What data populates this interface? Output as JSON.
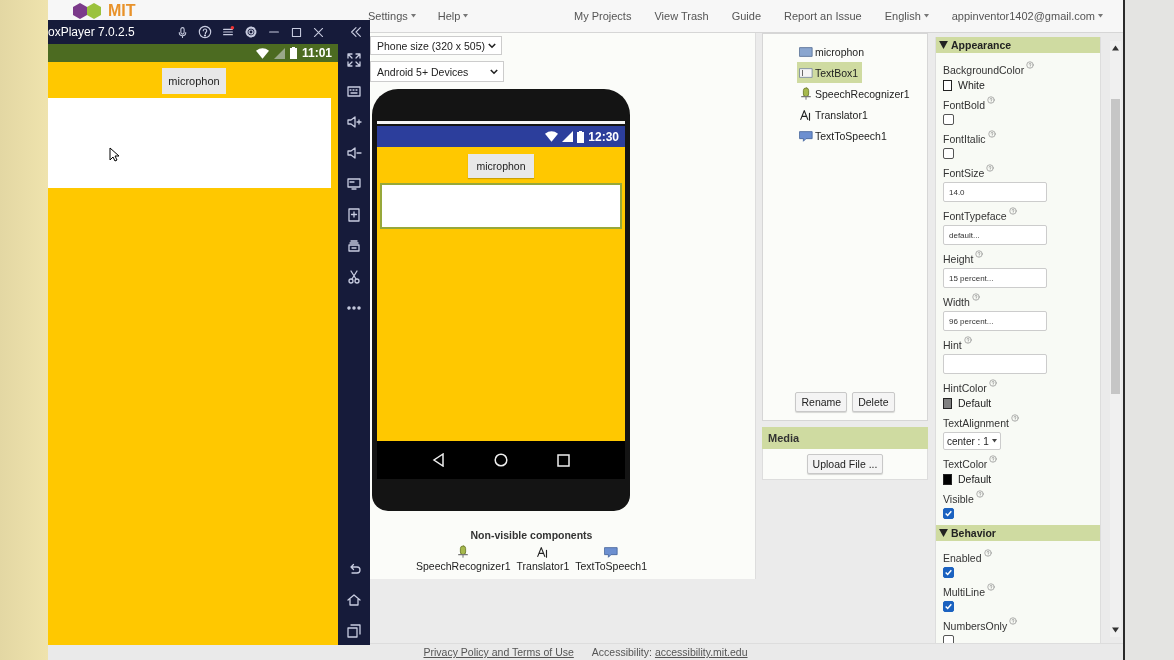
{
  "header": {
    "logo": "MIT",
    "menus": [
      {
        "label": "Settings"
      },
      {
        "label": "Help"
      }
    ],
    "links": [
      "My Projects",
      "View Trash",
      "Guide",
      "Report an Issue"
    ],
    "language": "English",
    "account": "appinventor1402@gmail.com"
  },
  "emulator": {
    "title": "oxPlayer 7.0.2.5",
    "time": "11:01",
    "app_button": "microphon"
  },
  "viewer": {
    "phone_size": "Phone size (320 x 505)",
    "device": "Android 5+ Devices",
    "time": "12:30",
    "app_button": "microphon",
    "nonvisible_title": "Non-visible components",
    "nonvisible": [
      {
        "kind": "speech",
        "label": "SpeechRecognizer1"
      },
      {
        "kind": "translator",
        "label": "Translator1"
      },
      {
        "kind": "tts",
        "label": "TextToSpeech1"
      }
    ]
  },
  "components": {
    "items": [
      {
        "kind": "button",
        "label": "microphon",
        "selected": false
      },
      {
        "kind": "textbox",
        "label": "TextBox1",
        "selected": true
      },
      {
        "kind": "speech",
        "label": "SpeechRecognizer1",
        "selected": false
      },
      {
        "kind": "translator",
        "label": "Translator1",
        "selected": false
      },
      {
        "kind": "tts",
        "label": "TextToSpeech1",
        "selected": false
      }
    ],
    "buttons": [
      "Rename",
      "Delete"
    ]
  },
  "media": {
    "title": "Media",
    "upload": "Upload File ..."
  },
  "properties": {
    "sections": [
      {
        "title": "Appearance",
        "expanded": true,
        "props": [
          {
            "name": "BackgroundColor",
            "kind": "color",
            "value": "White",
            "color": "#ffffff"
          },
          {
            "name": "FontBold",
            "kind": "checkbox",
            "checked": false
          },
          {
            "name": "FontItalic",
            "kind": "checkbox",
            "checked": false
          },
          {
            "name": "FontSize",
            "kind": "text",
            "value": "14.0"
          },
          {
            "name": "FontTypeface",
            "kind": "text",
            "value": "default..."
          },
          {
            "name": "Height",
            "kind": "text",
            "value": "15 percent..."
          },
          {
            "name": "Width",
            "kind": "text",
            "value": "96 percent..."
          },
          {
            "name": "Hint",
            "kind": "text"
          },
          {
            "name": "HintColor",
            "kind": "color",
            "value": "Default",
            "color": "#808080"
          },
          {
            "name": "TextAlignment",
            "kind": "select",
            "value": "center : 1"
          },
          {
            "name": "TextColor",
            "kind": "color",
            "value": "Default",
            "color": "#000000"
          },
          {
            "name": "Visible",
            "kind": "checkbox",
            "checked": true
          }
        ]
      },
      {
        "title": "Behavior",
        "expanded": true,
        "props": [
          {
            "name": "Enabled",
            "kind": "checkbox",
            "checked": true
          },
          {
            "name": "MultiLine",
            "kind": "checkbox",
            "checked": true
          },
          {
            "name": "NumbersOnly",
            "kind": "checkbox",
            "checked": false
          }
        ]
      }
    ]
  },
  "footer": {
    "privacy": "Privacy Policy and Terms of Use",
    "accessibility_label": "Accessibility:",
    "accessibility_link": "accessibility.mit.edu"
  }
}
